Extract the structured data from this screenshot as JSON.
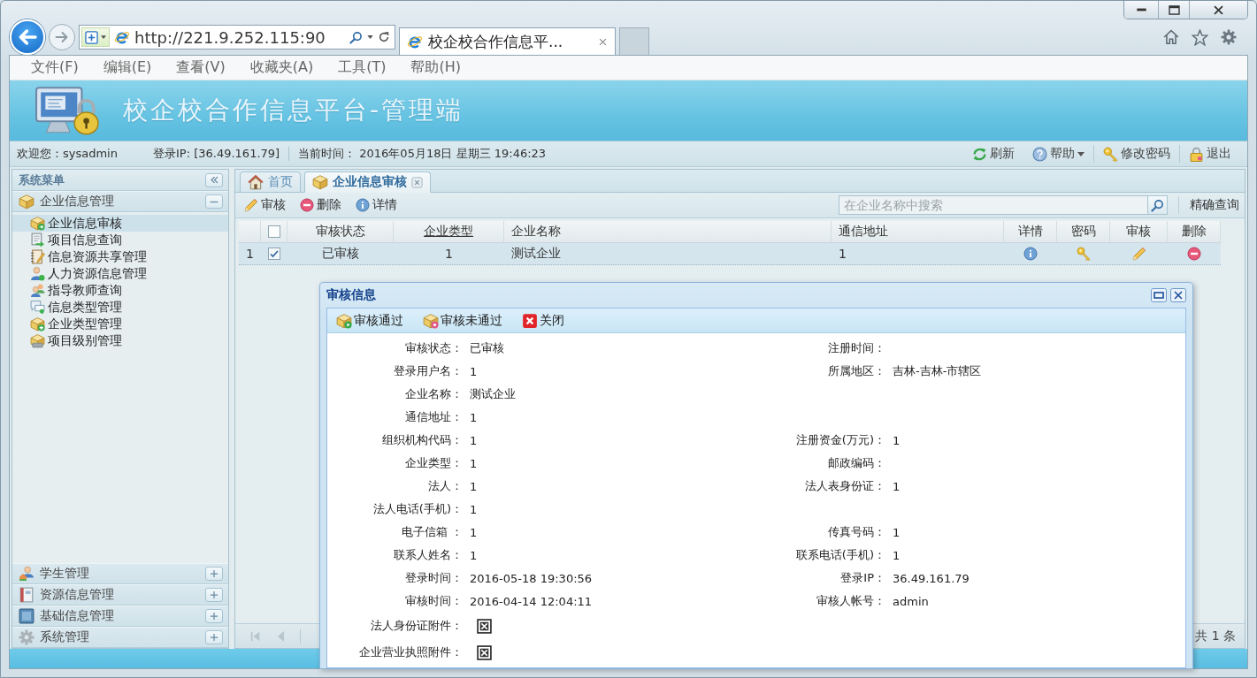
{
  "browser": {
    "url": "http://221.9.252.115:90",
    "tab_title": "校企校合作信息平..."
  },
  "menu": [
    "文件(F)",
    "编辑(E)",
    "查看(V)",
    "收藏夹(A)",
    "工具(T)",
    "帮助(H)"
  ],
  "header": {
    "title": "校企校合作信息平台-管理端"
  },
  "info_bar": {
    "welcome": "欢迎您：sysadmin",
    "login_ip": "登录IP:  [36.49.161.79]",
    "current_time": "当前时间： 2016年05月18日 星期三 19:46:23",
    "actions": [
      {
        "label": "刷新",
        "kind": "refresh",
        "dropdown": false
      },
      {
        "label": "帮助",
        "kind": "help",
        "dropdown": true
      },
      {
        "label": "修改密码",
        "kind": "password",
        "dropdown": false
      },
      {
        "label": "退出",
        "kind": "logout",
        "dropdown": false
      }
    ]
  },
  "sidebar": {
    "title": "系统菜单",
    "panels": [
      {
        "label": "企业信息管理",
        "kind": "package",
        "expanded": true,
        "items": [
          {
            "label": "企业信息审核",
            "kind": "package-arrow",
            "selected": true
          },
          {
            "label": "项目信息查询",
            "kind": "document-arrow",
            "selected": false
          },
          {
            "label": "信息资源共享管理",
            "kind": "notebook",
            "selected": false
          },
          {
            "label": "人力资源信息管理",
            "kind": "person",
            "selected": false
          },
          {
            "label": "指导教师查询",
            "kind": "people",
            "selected": false
          },
          {
            "label": "信息类型管理",
            "kind": "chat",
            "selected": false
          },
          {
            "label": "企业类型管理",
            "kind": "package-plus",
            "selected": false
          },
          {
            "label": "项目级别管理",
            "kind": "package-tray",
            "selected": false
          }
        ]
      },
      {
        "label": "学生管理",
        "kind": "student",
        "expanded": false
      },
      {
        "label": "资源信息管理",
        "kind": "book",
        "expanded": false
      },
      {
        "label": "基础信息管理",
        "kind": "tile",
        "expanded": false
      },
      {
        "label": "系统管理",
        "kind": "gear",
        "expanded": false
      }
    ]
  },
  "tabs": [
    {
      "label": "首页",
      "kind": "home",
      "selected": false,
      "closable": false
    },
    {
      "label": "企业信息审核",
      "kind": "package",
      "selected": true,
      "closable": true
    }
  ],
  "toolbar": {
    "buttons": [
      {
        "label": "审核",
        "kind": "edit"
      },
      {
        "label": "删除",
        "kind": "delete"
      },
      {
        "label": "详情",
        "kind": "info"
      }
    ],
    "search": {
      "placeholder": "在企业名称中搜索"
    },
    "exact_search": "精确查询"
  },
  "table": {
    "header_checked": false,
    "columns": [
      {
        "label": "审核状态",
        "kind": "text",
        "sorted": false
      },
      {
        "label": "企业类型",
        "kind": "text",
        "sorted": true
      },
      {
        "label": "企业名称",
        "kind": "text",
        "sorted": false
      },
      {
        "label": "通信地址",
        "kind": "text",
        "sorted": false
      },
      {
        "label": "详情",
        "kind": "info",
        "sorted": false
      },
      {
        "label": "密码",
        "kind": "key",
        "sorted": false
      },
      {
        "label": "审核",
        "kind": "edit",
        "sorted": false
      },
      {
        "label": "删除",
        "kind": "delete",
        "sorted": false
      }
    ],
    "rows": [
      {
        "number": "1",
        "checked": true,
        "selected": true,
        "cells": [
          "已审核",
          "1",
          "测试企业",
          "1"
        ]
      }
    ]
  },
  "pagination": {
    "total": "共 1 条"
  },
  "dialog": {
    "title": "审核信息",
    "buttons": [
      {
        "label": "审核通过",
        "kind": "approve"
      },
      {
        "label": "审核未通过",
        "kind": "reject"
      },
      {
        "label": "关闭",
        "kind": "close"
      }
    ],
    "rows": [
      {
        "left": {
          "kind": "text",
          "label": "审核状态：",
          "value": "已审核"
        },
        "right": {
          "kind": "text",
          "label": "注册时间："
        }
      },
      {
        "left": {
          "kind": "text",
          "label": "登录用户名：",
          "value": "1"
        },
        "right": {
          "kind": "text",
          "label": "所属地区：",
          "value": "吉林-吉林-市辖区"
        }
      },
      {
        "left": {
          "kind": "text",
          "label": "企业名称：",
          "value": "测试企业"
        }
      },
      {
        "left": {
          "kind": "text",
          "label": "通信地址：",
          "value": "1"
        }
      },
      {
        "left": {
          "kind": "text",
          "label": "组织机构代码：",
          "value": "1"
        },
        "right": {
          "kind": "text",
          "label": "注册资金(万元)：",
          "value": "1"
        }
      },
      {
        "left": {
          "kind": "text",
          "label": "企业类型：",
          "value": "1"
        },
        "right": {
          "kind": "text",
          "label": "邮政编码："
        }
      },
      {
        "left": {
          "kind": "text",
          "label": "法人：",
          "value": "1"
        },
        "right": {
          "kind": "text",
          "label": "法人表身份证：",
          "value": "1"
        }
      },
      {
        "left": {
          "kind": "text",
          "label": "法人电话(手机)：",
          "value": "1"
        }
      },
      {
        "left": {
          "kind": "text",
          "label": "电子信箱 ：",
          "value": "1"
        },
        "right": {
          "kind": "text",
          "label": "传真号码：",
          "value": "1"
        }
      },
      {
        "left": {
          "kind": "text",
          "label": "联系人姓名：",
          "value": "1"
        },
        "right": {
          "kind": "text",
          "label": "联系电话(手机)：",
          "value": "1"
        }
      },
      {
        "left": {
          "kind": "text",
          "label": "登录时间：",
          "value": "2016-05-18 19:30:56"
        },
        "right": {
          "kind": "text",
          "label": "登录IP：",
          "value": "36.49.161.79"
        }
      },
      {
        "left": {
          "kind": "text",
          "label": "审核时间：",
          "value": "2016-04-14 12:04:11"
        },
        "right": {
          "kind": "text",
          "label": "审核人帐号：",
          "value": "admin"
        }
      },
      {
        "left": {
          "kind": "attachment",
          "label": "法人身份证附件："
        }
      },
      {
        "left": {
          "kind": "attachment",
          "label": "企业营业执照附件："
        }
      }
    ]
  }
}
